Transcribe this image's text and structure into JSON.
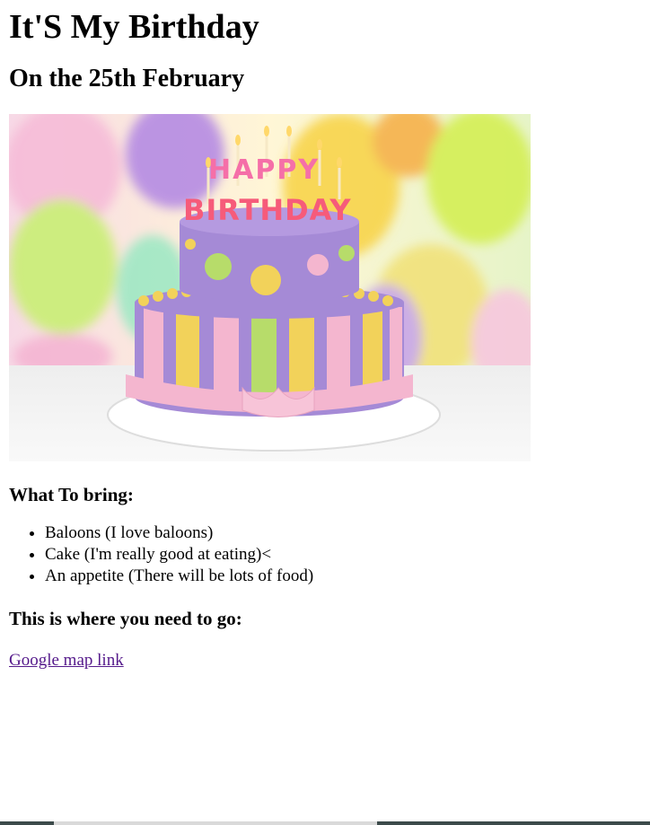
{
  "page": {
    "title": "It'S My Birthday",
    "subtitle": "On the 25th February",
    "image_alt": "Birthday cake",
    "image_text": "HAPPY BIRTHDAY",
    "bring_heading": "What To bring:",
    "bring_items": [
      "Baloons (I love baloons)",
      "Cake (I'm really good at eating)<",
      "An appetite (There will be lots of food)"
    ],
    "go_heading": "This is where you need to go:",
    "map_link": "Google map link"
  },
  "colors": {
    "link_visited": "#551a8b",
    "cake_purple": "#a58ad6",
    "cake_pink": "#f4b6cf",
    "cake_yellow": "#f2d25a"
  }
}
